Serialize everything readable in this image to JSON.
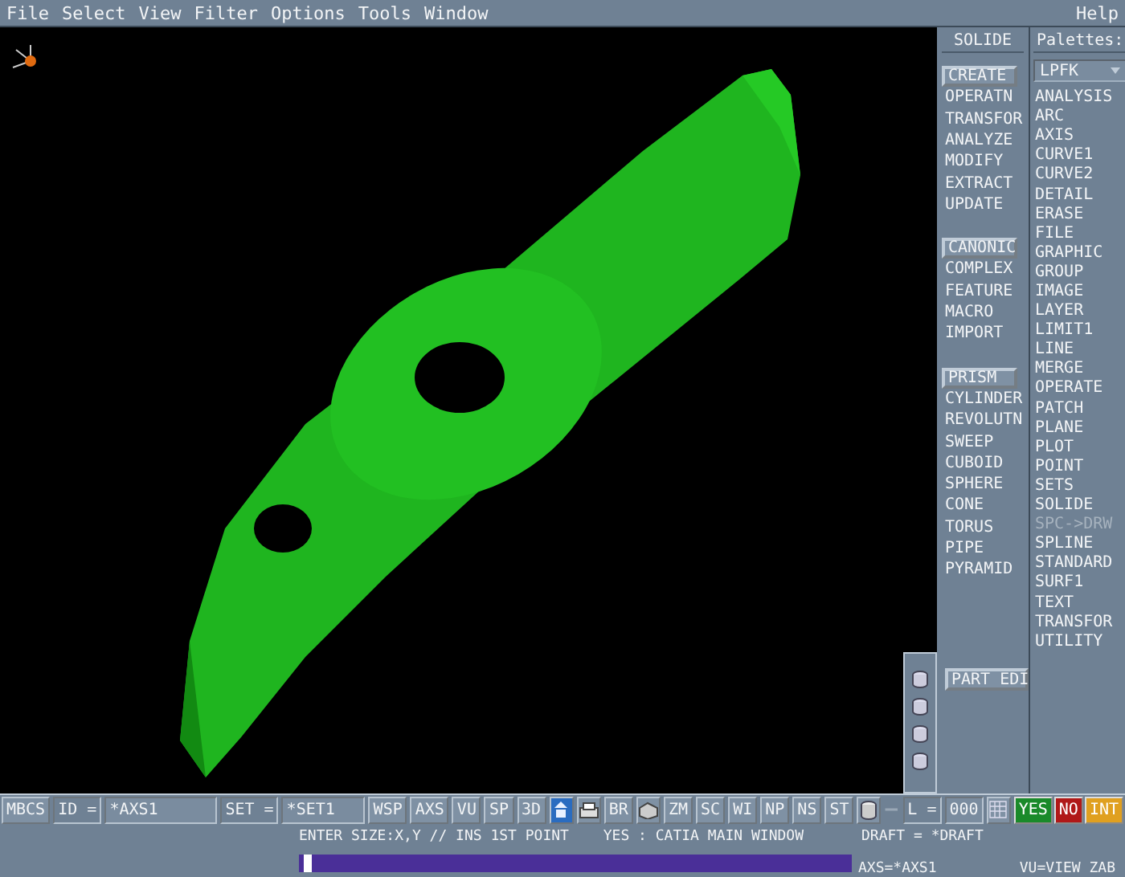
{
  "menu": {
    "items": [
      "File",
      "Select",
      "View",
      "Filter",
      "Options",
      "Tools",
      "Window"
    ],
    "help": "Help"
  },
  "workbench": {
    "title": "SOLIDE",
    "groups": [
      {
        "items": [
          {
            "label": "CREATE",
            "selected": true
          },
          {
            "label": "OPERATN",
            "selected": false
          },
          {
            "label": "TRANSFOR",
            "selected": false
          },
          {
            "label": "ANALYZE",
            "selected": false
          },
          {
            "label": "MODIFY",
            "selected": false
          },
          {
            "label": "EXTRACT",
            "selected": false
          },
          {
            "label": "UPDATE",
            "selected": false
          }
        ]
      },
      {
        "items": [
          {
            "label": "CANONIC",
            "selected": true
          },
          {
            "label": "COMPLEX",
            "selected": false
          },
          {
            "label": "FEATURE",
            "selected": false
          },
          {
            "label": "MACRO",
            "selected": false
          },
          {
            "label": "IMPORT",
            "selected": false
          }
        ]
      },
      {
        "items": [
          {
            "label": "PRISM",
            "selected": true
          },
          {
            "label": "CYLINDER",
            "selected": false
          },
          {
            "label": "REVOLUTN",
            "selected": false
          },
          {
            "label": "SWEEP",
            "selected": false
          },
          {
            "label": "CUBOID",
            "selected": false
          },
          {
            "label": "SPHERE",
            "selected": false
          },
          {
            "label": "CONE",
            "selected": false
          },
          {
            "label": "TORUS",
            "selected": false
          },
          {
            "label": "PIPE",
            "selected": false
          },
          {
            "label": "PYRAMID",
            "selected": false
          }
        ]
      }
    ],
    "part_button": "PART EDI"
  },
  "palettes": {
    "title": "Palettes:",
    "dropdown": "LPFK",
    "items": [
      {
        "label": "ANALYSIS",
        "disabled": false
      },
      {
        "label": "ARC",
        "disabled": false
      },
      {
        "label": "AXIS",
        "disabled": false
      },
      {
        "label": "CURVE1",
        "disabled": false
      },
      {
        "label": "CURVE2",
        "disabled": false
      },
      {
        "label": "DETAIL",
        "disabled": false
      },
      {
        "label": "ERASE",
        "disabled": false
      },
      {
        "label": "FILE",
        "disabled": false
      },
      {
        "label": "GRAPHIC",
        "disabled": false
      },
      {
        "label": "GROUP",
        "disabled": false
      },
      {
        "label": "IMAGE",
        "disabled": false
      },
      {
        "label": "LAYER",
        "disabled": false
      },
      {
        "label": "LIMIT1",
        "disabled": false
      },
      {
        "label": "LINE",
        "disabled": false
      },
      {
        "label": "MERGE",
        "disabled": false
      },
      {
        "label": "OPERATE",
        "disabled": false
      },
      {
        "label": "PATCH",
        "disabled": false
      },
      {
        "label": "PLANE",
        "disabled": false
      },
      {
        "label": "PLOT",
        "disabled": false
      },
      {
        "label": "POINT",
        "disabled": false
      },
      {
        "label": "SETS",
        "disabled": false
      },
      {
        "label": "SOLIDE",
        "disabled": false
      },
      {
        "label": "SPC->DRW",
        "disabled": true
      },
      {
        "label": "SPLINE",
        "disabled": false
      },
      {
        "label": "STANDARD",
        "disabled": false
      },
      {
        "label": "SURF1",
        "disabled": false
      },
      {
        "label": "TEXT",
        "disabled": false
      },
      {
        "label": "TRANSFOR",
        "disabled": false
      },
      {
        "label": "UTILITY",
        "disabled": false
      }
    ]
  },
  "toolbar": {
    "mode": "MBCS",
    "id_label": "ID =",
    "id_value": "*AXS1",
    "set_label": "SET =",
    "set_value": "*SET1",
    "buttons_a": [
      "WSP",
      "AXS",
      "VU",
      "SP",
      "3D"
    ],
    "button_b": "BR",
    "buttons_c": [
      "ZM",
      "SC",
      "WI",
      "NP",
      "NS",
      "ST"
    ],
    "l_label": "L =",
    "l_value": "000",
    "answers": [
      {
        "label": "YES",
        "color": "#1a8a2a"
      },
      {
        "label": "NO",
        "color": "#b01818"
      },
      {
        "label": "INT",
        "color": "#e0a020"
      }
    ]
  },
  "status": {
    "prompt": "ENTER SIZE:X,Y // INS 1ST POINT",
    "message": "YES : CATIA MAIN WINDOW",
    "draft": "DRAFT = *DRAFT",
    "axis": "AXS=*AXS1",
    "view": "VU=VIEW ZAB"
  }
}
